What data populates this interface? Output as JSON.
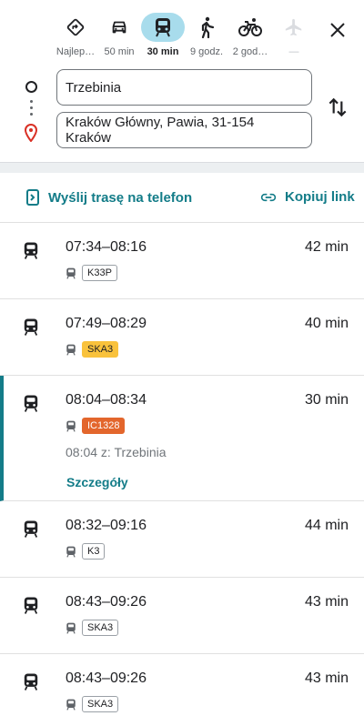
{
  "modes": [
    {
      "name": "best",
      "label": "Najlep…",
      "icon": "directions-diamond-icon"
    },
    {
      "name": "car",
      "label": "50 min",
      "icon": "car-icon"
    },
    {
      "name": "transit",
      "label": "30 min",
      "icon": "train-icon",
      "active": true
    },
    {
      "name": "walk",
      "label": "9 godz.",
      "icon": "walk-icon"
    },
    {
      "name": "bike",
      "label": "2 god…",
      "icon": "bike-icon"
    },
    {
      "name": "flight",
      "label": "—",
      "icon": "plane-icon",
      "disabled": true
    }
  ],
  "origin": "Trzebinia",
  "destination": "Kraków Główny, Pawia, 31-154 Kraków",
  "actions": {
    "send": "Wyślij trasę na telefon",
    "copy": "Kopiuj link"
  },
  "trips": [
    {
      "time": "07:34–08:16",
      "duration": "42 min",
      "line": "K33P",
      "badge_style": "plain"
    },
    {
      "time": "07:49–08:29",
      "duration": "40 min",
      "line": "SKA3",
      "badge_style": "yellow"
    },
    {
      "time": "08:04–08:34",
      "duration": "30 min",
      "line": "IC1328",
      "badge_style": "orange",
      "departure": "08:04 z: Trzebinia",
      "details": "Szczegóły"
    },
    {
      "time": "08:32–09:16",
      "duration": "44 min",
      "line": "K3",
      "badge_style": "plain"
    },
    {
      "time": "08:43–09:26",
      "duration": "43 min",
      "line": "SKA3",
      "badge_style": "plain"
    },
    {
      "time": "08:43–09:26",
      "duration": "43 min",
      "line": "SKA3",
      "badge_style": "plain"
    }
  ],
  "colors": {
    "accent": "#137c88",
    "active_mode_bg": "#a8dcec",
    "yellow_badge": "#f9c23c",
    "orange_badge": "#e3662c"
  }
}
